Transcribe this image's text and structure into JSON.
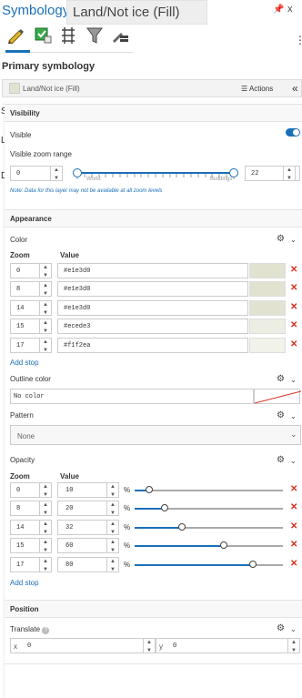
{
  "titlebar": {
    "title": "Symbology",
    "tooltip": "Land/Not ice (Fill)",
    "pin_icon": "pin-icon",
    "close_glyph": "x"
  },
  "toolbar": {
    "tools": [
      "primary-symbology-icon",
      "vary-symbology-icon",
      "symbol-layer-drawing-icon",
      "symbol-filter-icon",
      "label-classes-icon"
    ],
    "menu_icon": "hamburger-icon"
  },
  "primary": {
    "heading": "Primary symbology",
    "symbol_label": "Land/Not ice (Fill)",
    "actions_label": "Actions",
    "collapse_glyph": "«",
    "symbol_color": "#e1e3d0"
  },
  "behind": {
    "s": "S",
    "l": "L",
    "d": "D"
  },
  "visibility": {
    "header": "Visibility",
    "visible_label": "Visible",
    "visible_on": true,
    "zoom_range_label": "Visible zoom range",
    "min_zoom": "0",
    "max_zoom": "22",
    "left_mark": "World",
    "right_mark": "Buildings",
    "note": "Note: Data for this layer may not be available at all zoom levels"
  },
  "appearance": {
    "header": "Appearance",
    "color": {
      "label": "Color",
      "col_zoom": "Zoom",
      "col_value": "Value",
      "stops": [
        {
          "zoom": "0",
          "value": "#e1e3d0"
        },
        {
          "zoom": "8",
          "value": "#e1e3d0"
        },
        {
          "zoom": "14",
          "value": "#e1e3d0"
        },
        {
          "zoom": "15",
          "value": "#ecede3"
        },
        {
          "zoom": "17",
          "value": "#f1f2ea"
        }
      ],
      "add_stop": "Add stop"
    },
    "outline": {
      "label": "Outline color",
      "value": "No color"
    },
    "pattern": {
      "label": "Pattern",
      "value": "None"
    },
    "opacity": {
      "label": "Opacity",
      "col_zoom": "Zoom",
      "col_value": "Value",
      "unit": "%",
      "stops": [
        {
          "zoom": "0",
          "value": "10"
        },
        {
          "zoom": "8",
          "value": "20"
        },
        {
          "zoom": "14",
          "value": "32"
        },
        {
          "zoom": "15",
          "value": "60"
        },
        {
          "zoom": "17",
          "value": "80"
        }
      ],
      "add_stop": "Add stop"
    }
  },
  "position": {
    "header": "Position",
    "translate_label": "Translate",
    "x_label": "x",
    "x_value": "0",
    "y_label": "y",
    "y_value": "0"
  },
  "colors": {
    "accent": "#1a70b8",
    "remove": "#d83020"
  }
}
